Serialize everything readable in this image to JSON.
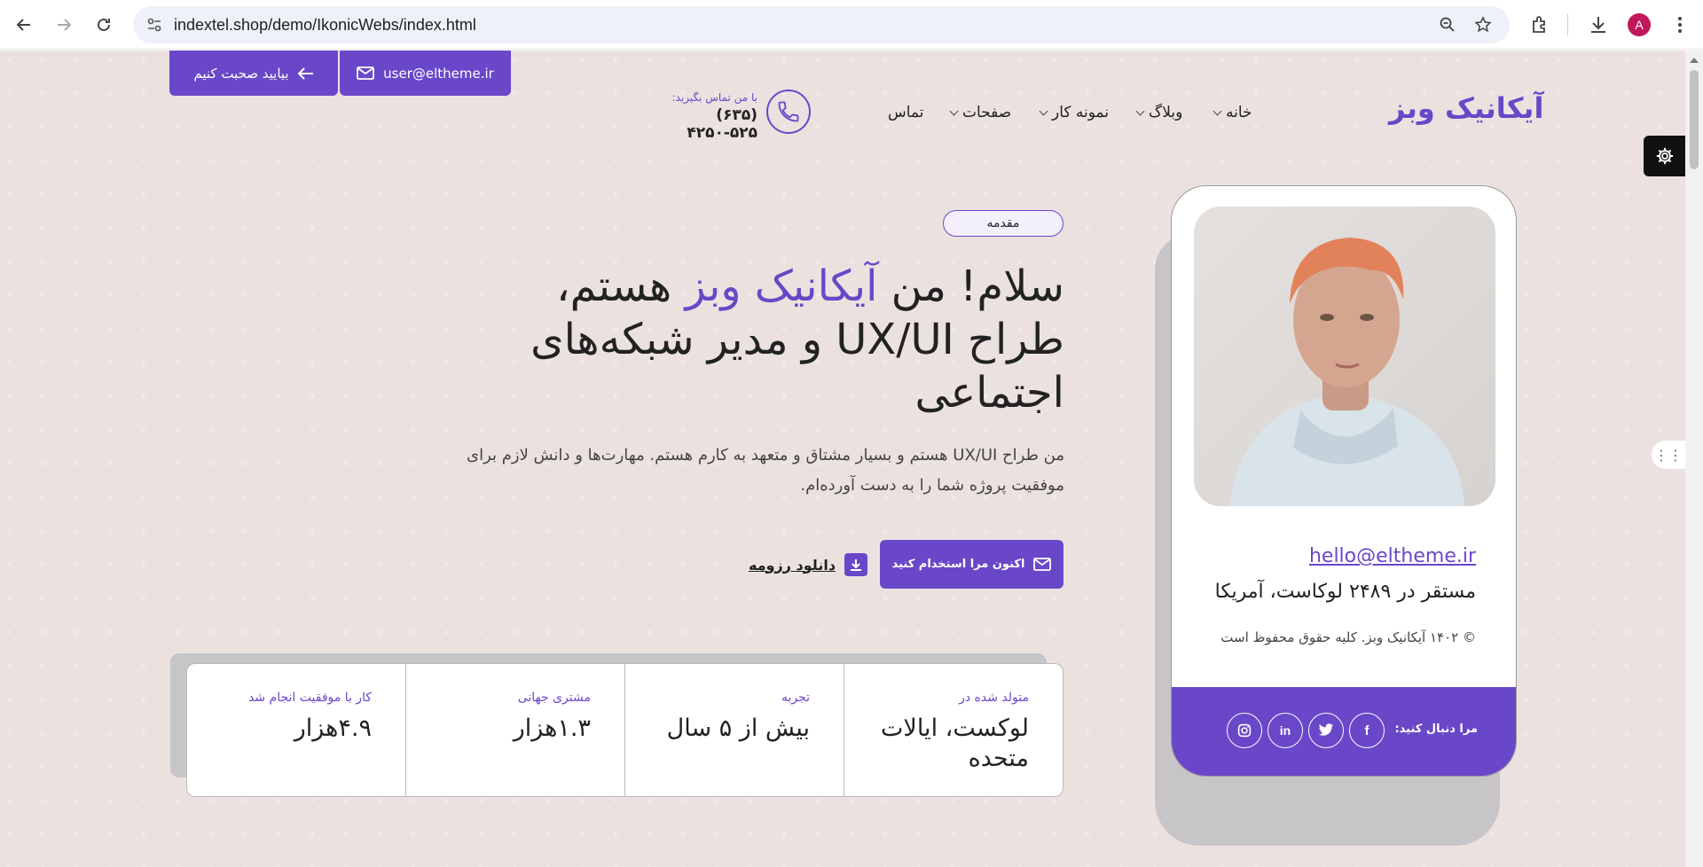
{
  "browser": {
    "url": "indextel.shop/demo/IkonicWebs/index.html",
    "profile_initial": "A"
  },
  "header": {
    "email_button": "user@eltheme.ir",
    "talk_button": "بیایید صحبت کنیم",
    "contact_label": "با من تماس بگیرید:",
    "phone": "(۶۳۵) ۴۲۵۰-۵۲۵",
    "logo": "آیکانیک وبز",
    "menu": [
      {
        "label": "خانه",
        "dropdown": true
      },
      {
        "label": "وبلاگ",
        "dropdown": true
      },
      {
        "label": "نمونه کار",
        "dropdown": true
      },
      {
        "label": "صفحات",
        "dropdown": true
      },
      {
        "label": "تماس",
        "dropdown": false
      }
    ]
  },
  "hero": {
    "badge": "مقدمه",
    "title_part1": "سلام! من ",
    "title_highlight": "آیکانیک وبز",
    "title_part2": " هستم،",
    "title_line2": "طراح UX/UI و مدیر شبکه‌های",
    "title_line3": "اجتماعی",
    "description": "من طراح UX/UI هستم و بسیار مشتاق و متعهد به کارم هستم. مهارت‌ها و دانش لازم برای موفقیت پروژه شما را به دست آورده‌ام.",
    "hire_button": "اکنون مرا استخدام کنید",
    "download_link": "دانلود رزومه"
  },
  "stats": [
    {
      "label": "متولد شده در",
      "value": "لوکست، ایالات متحده"
    },
    {
      "label": "تجربه",
      "value": "بیش از ۵ سال"
    },
    {
      "label": "مشتری جهانی",
      "value": "۱.۳هزار"
    },
    {
      "label": "کار با موفقیت انجام شد",
      "value": "۴.۹هزار"
    }
  ],
  "profile": {
    "email": "hello@eltheme.ir",
    "address": "مستقر در ۲۴۸۹ لوکاست، آمریکا",
    "copyright": "© ۱۴۰۲ آیکانیک وبز. کلیه حقوق محفوظ است",
    "follow_label": "مرا دنبال کنید:",
    "socials": [
      "facebook-icon",
      "twitter-icon",
      "linkedin-icon",
      "instagram-icon"
    ]
  },
  "colors": {
    "accent": "#6a47c8",
    "page_bg": "#ebe2e0"
  }
}
